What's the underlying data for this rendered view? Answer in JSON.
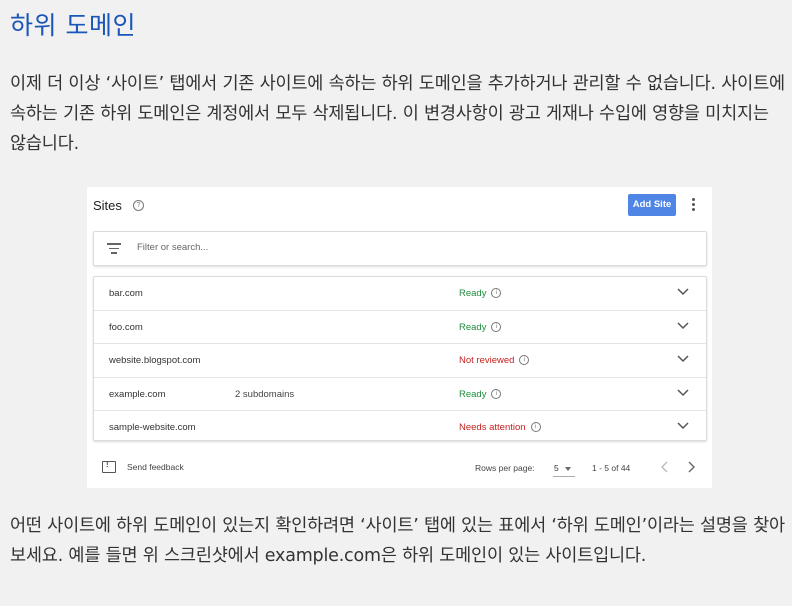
{
  "heading": "하위 도메인",
  "paragraph1": "이제 더 이상 ‘사이트’ 탭에서 기존 사이트에 속하는 하위 도메인을 추가하거나 관리할 수 없습니다. 사이트에 속하는 기존 하위 도메인은 계정에서 모두 삭제됩니다. 이 변경사항이 광고 게재나 수입에 영향을 미치지는 않습니다.",
  "screenshot": {
    "title": "Sites",
    "help_icon": "help-circle-icon",
    "add_button": "Add Site",
    "more_icon": "more-vert-icon",
    "filter_icon": "filter-list-icon",
    "filter_placeholder": "Filter or search...",
    "rows": [
      {
        "domain": "bar.com",
        "subdomains": "",
        "status": "Ready",
        "status_color": "#1e8e3e"
      },
      {
        "domain": "foo.com",
        "subdomains": "",
        "status": "Ready",
        "status_color": "#1e8e3e"
      },
      {
        "domain": "website.blogspot.com",
        "subdomains": "",
        "status": "Not reviewed",
        "status_color": "#c5221f"
      },
      {
        "domain": "example.com",
        "subdomains": "2 subdomains",
        "status": "Ready",
        "status_color": "#1e8e3e"
      },
      {
        "domain": "sample-website.com",
        "subdomains": "",
        "status": "Needs attention",
        "status_color": "#c5221f"
      }
    ],
    "footer": {
      "feedback": "Send feedback",
      "rows_per_page_label": "Rows per page:",
      "rows_per_page_value": "5",
      "range": "1 - 5 of 44"
    }
  },
  "paragraph2": "어떤 사이트에 하위 도메인이 있는지 확인하려면 ‘사이트’ 탭에 있는 표에서 ‘하위 도메인’이라는 설명을 찾아보세요. 예를 들면 위 스크린샷에서 example.com은 하위 도메인이 있는 사이트입니다."
}
